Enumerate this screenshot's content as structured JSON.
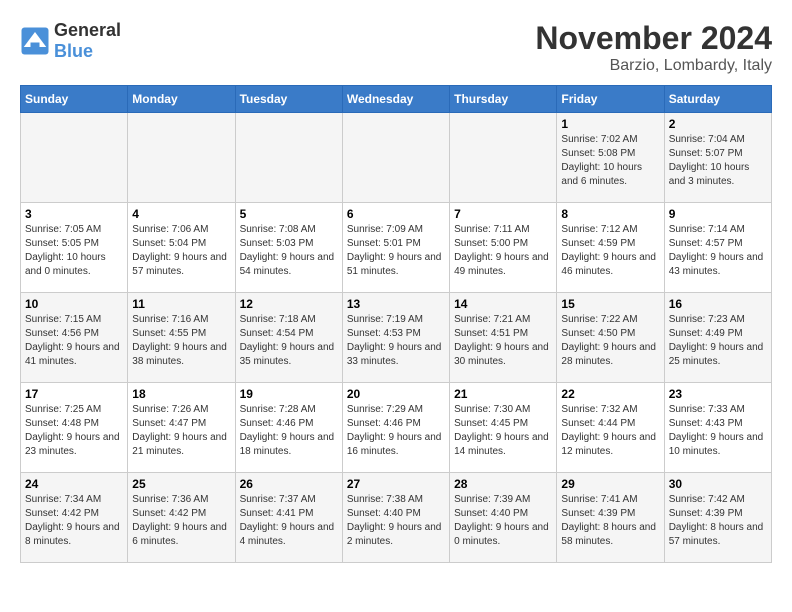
{
  "header": {
    "logo_general": "General",
    "logo_blue": "Blue",
    "month": "November 2024",
    "location": "Barzio, Lombardy, Italy"
  },
  "days_of_week": [
    "Sunday",
    "Monday",
    "Tuesday",
    "Wednesday",
    "Thursday",
    "Friday",
    "Saturday"
  ],
  "weeks": [
    [
      {
        "day": "",
        "info": ""
      },
      {
        "day": "",
        "info": ""
      },
      {
        "day": "",
        "info": ""
      },
      {
        "day": "",
        "info": ""
      },
      {
        "day": "",
        "info": ""
      },
      {
        "day": "1",
        "info": "Sunrise: 7:02 AM\nSunset: 5:08 PM\nDaylight: 10 hours and 6 minutes."
      },
      {
        "day": "2",
        "info": "Sunrise: 7:04 AM\nSunset: 5:07 PM\nDaylight: 10 hours and 3 minutes."
      }
    ],
    [
      {
        "day": "3",
        "info": "Sunrise: 7:05 AM\nSunset: 5:05 PM\nDaylight: 10 hours and 0 minutes."
      },
      {
        "day": "4",
        "info": "Sunrise: 7:06 AM\nSunset: 5:04 PM\nDaylight: 9 hours and 57 minutes."
      },
      {
        "day": "5",
        "info": "Sunrise: 7:08 AM\nSunset: 5:03 PM\nDaylight: 9 hours and 54 minutes."
      },
      {
        "day": "6",
        "info": "Sunrise: 7:09 AM\nSunset: 5:01 PM\nDaylight: 9 hours and 51 minutes."
      },
      {
        "day": "7",
        "info": "Sunrise: 7:11 AM\nSunset: 5:00 PM\nDaylight: 9 hours and 49 minutes."
      },
      {
        "day": "8",
        "info": "Sunrise: 7:12 AM\nSunset: 4:59 PM\nDaylight: 9 hours and 46 minutes."
      },
      {
        "day": "9",
        "info": "Sunrise: 7:14 AM\nSunset: 4:57 PM\nDaylight: 9 hours and 43 minutes."
      }
    ],
    [
      {
        "day": "10",
        "info": "Sunrise: 7:15 AM\nSunset: 4:56 PM\nDaylight: 9 hours and 41 minutes."
      },
      {
        "day": "11",
        "info": "Sunrise: 7:16 AM\nSunset: 4:55 PM\nDaylight: 9 hours and 38 minutes."
      },
      {
        "day": "12",
        "info": "Sunrise: 7:18 AM\nSunset: 4:54 PM\nDaylight: 9 hours and 35 minutes."
      },
      {
        "day": "13",
        "info": "Sunrise: 7:19 AM\nSunset: 4:53 PM\nDaylight: 9 hours and 33 minutes."
      },
      {
        "day": "14",
        "info": "Sunrise: 7:21 AM\nSunset: 4:51 PM\nDaylight: 9 hours and 30 minutes."
      },
      {
        "day": "15",
        "info": "Sunrise: 7:22 AM\nSunset: 4:50 PM\nDaylight: 9 hours and 28 minutes."
      },
      {
        "day": "16",
        "info": "Sunrise: 7:23 AM\nSunset: 4:49 PM\nDaylight: 9 hours and 25 minutes."
      }
    ],
    [
      {
        "day": "17",
        "info": "Sunrise: 7:25 AM\nSunset: 4:48 PM\nDaylight: 9 hours and 23 minutes."
      },
      {
        "day": "18",
        "info": "Sunrise: 7:26 AM\nSunset: 4:47 PM\nDaylight: 9 hours and 21 minutes."
      },
      {
        "day": "19",
        "info": "Sunrise: 7:28 AM\nSunset: 4:46 PM\nDaylight: 9 hours and 18 minutes."
      },
      {
        "day": "20",
        "info": "Sunrise: 7:29 AM\nSunset: 4:46 PM\nDaylight: 9 hours and 16 minutes."
      },
      {
        "day": "21",
        "info": "Sunrise: 7:30 AM\nSunset: 4:45 PM\nDaylight: 9 hours and 14 minutes."
      },
      {
        "day": "22",
        "info": "Sunrise: 7:32 AM\nSunset: 4:44 PM\nDaylight: 9 hours and 12 minutes."
      },
      {
        "day": "23",
        "info": "Sunrise: 7:33 AM\nSunset: 4:43 PM\nDaylight: 9 hours and 10 minutes."
      }
    ],
    [
      {
        "day": "24",
        "info": "Sunrise: 7:34 AM\nSunset: 4:42 PM\nDaylight: 9 hours and 8 minutes."
      },
      {
        "day": "25",
        "info": "Sunrise: 7:36 AM\nSunset: 4:42 PM\nDaylight: 9 hours and 6 minutes."
      },
      {
        "day": "26",
        "info": "Sunrise: 7:37 AM\nSunset: 4:41 PM\nDaylight: 9 hours and 4 minutes."
      },
      {
        "day": "27",
        "info": "Sunrise: 7:38 AM\nSunset: 4:40 PM\nDaylight: 9 hours and 2 minutes."
      },
      {
        "day": "28",
        "info": "Sunrise: 7:39 AM\nSunset: 4:40 PM\nDaylight: 9 hours and 0 minutes."
      },
      {
        "day": "29",
        "info": "Sunrise: 7:41 AM\nSunset: 4:39 PM\nDaylight: 8 hours and 58 minutes."
      },
      {
        "day": "30",
        "info": "Sunrise: 7:42 AM\nSunset: 4:39 PM\nDaylight: 8 hours and 57 minutes."
      }
    ]
  ]
}
